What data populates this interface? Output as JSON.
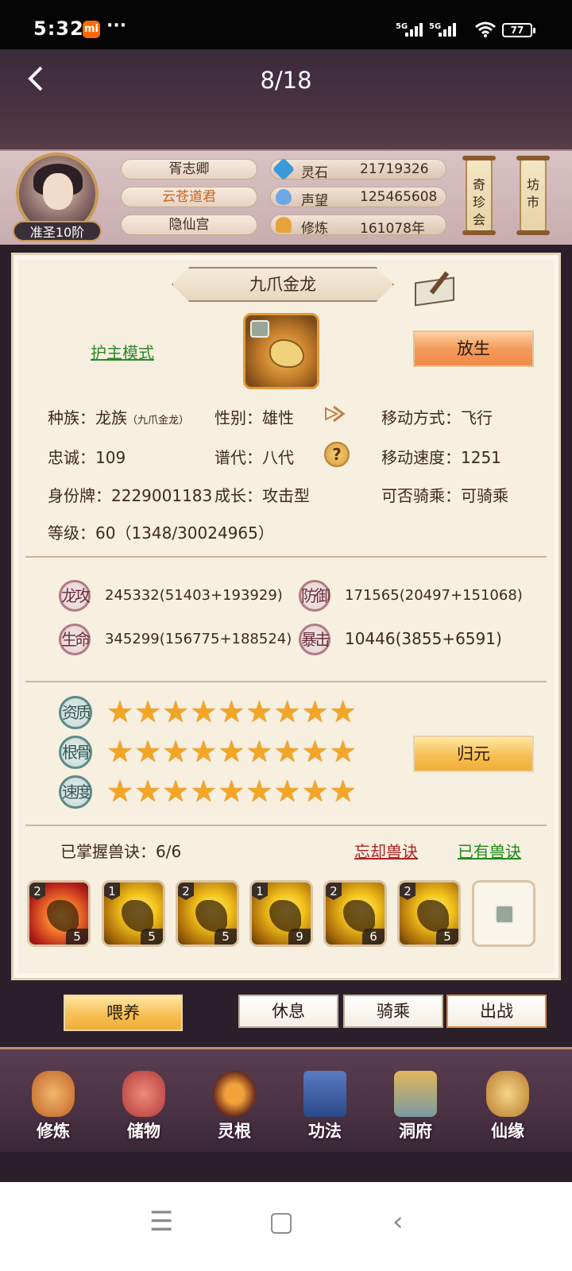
{
  "status": {
    "time": "5:32",
    "mi": "mi",
    "dots": "···",
    "sig1": "5G",
    "sig2": "5G",
    "wifi": "wifi-icon",
    "battery": "77"
  },
  "title": {
    "page": "8/18"
  },
  "player": {
    "name": "胥志卿",
    "title": "云苍道君",
    "sect": "隐仙宫",
    "rank": "准圣10阶"
  },
  "resources": [
    {
      "label": "灵石",
      "value": "21719326",
      "icon": "spirit-stone-icon"
    },
    {
      "label": "声望",
      "value": "125465608",
      "icon": "prestige-icon"
    },
    {
      "label": "修炼",
      "value": "161078年",
      "icon": "cultivation-icon"
    }
  ],
  "scrolls": {
    "market1": "奇珍会",
    "market2": "坊市"
  },
  "pet": {
    "name": "九爪金龙",
    "guard_mode": "护主模式",
    "release": "放生"
  },
  "info": {
    "race_label": "种族：",
    "race": "龙族",
    "race_sub": "（九爪金龙）",
    "gender_label": "性别：",
    "gender": "雄性",
    "move_label": "移动方式：",
    "move": "飞行",
    "loyalty_label": "忠诚：",
    "loyalty": "109",
    "gen_label": "谱代：",
    "gen": "八代",
    "speed_label": "移动速度：",
    "speed": "1251",
    "id_label": "身份牌：",
    "id": "2229001183",
    "growth_label": "成长：",
    "growth": "攻击型",
    "ride_label": "可否骑乘：",
    "ride": "可骑乘",
    "level_label": "等级：",
    "level": "60（1348/30024965）"
  },
  "stats": [
    {
      "badge": "龙攻",
      "value": "245332(51403+193929)"
    },
    {
      "badge": "防御",
      "value": "171565(20497+151068)"
    },
    {
      "badge": "生命",
      "value": "345299(156775+188524)"
    },
    {
      "badge": "暴击",
      "value": "10446(3855+6591)"
    }
  ],
  "qualities": [
    {
      "badge": "资质",
      "stars": 9
    },
    {
      "badge": "根骨",
      "stars": 9
    },
    {
      "badge": "速度",
      "stars": 9
    }
  ],
  "return_btn": "归元",
  "skills_header": {
    "mastered": "已掌握兽诀：6/6",
    "forget": "忘却兽诀",
    "have": "已有兽诀"
  },
  "skills": [
    {
      "tier": "2",
      "level": "5"
    },
    {
      "tier": "1",
      "level": "5"
    },
    {
      "tier": "2",
      "level": "5"
    },
    {
      "tier": "1",
      "level": "9"
    },
    {
      "tier": "2",
      "level": "6"
    },
    {
      "tier": "2",
      "level": "5"
    }
  ],
  "actions": {
    "feed": "喂养",
    "rest": "休息",
    "ride": "骑乘",
    "fight": "出战"
  },
  "nav": [
    {
      "label": "修炼",
      "icon": "cultivate-icon"
    },
    {
      "label": "储物",
      "icon": "storage-bag-icon"
    },
    {
      "label": "灵根",
      "icon": "spirit-root-icon"
    },
    {
      "label": "功法",
      "icon": "technique-book-icon"
    },
    {
      "label": "洞府",
      "icon": "cave-mansion-icon"
    },
    {
      "label": "仙缘",
      "icon": "immortal-fate-icon"
    }
  ],
  "colors": {
    "accent_orange": "#f08a48",
    "gold": "#f7c055",
    "star": "#f3a625",
    "green_link": "#2a8a2a",
    "red_link": "#b02222"
  }
}
